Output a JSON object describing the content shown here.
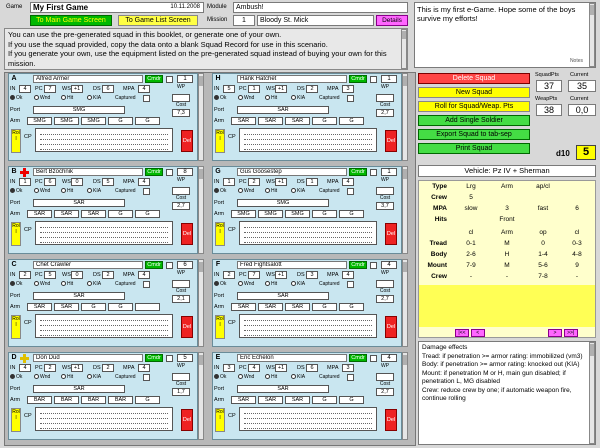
{
  "header": {
    "game_label": "Game",
    "game_name": "My First Game",
    "date": "10.11.2008",
    "module_label": "Module",
    "module_value": "Ambush!",
    "mission_label": "Mission",
    "mission_number": "1",
    "mission_name": "Bloody St. Mick",
    "details_btn": "Details",
    "main_btn": "To Main Game Screen",
    "table_btn": "To Game List Screen",
    "notes_text": "This is my first e-Game. Hope some of the boys survive my efforts!",
    "notes_label": "Notes"
  },
  "instructions": "You can use the pre-generated squad in this booklet, or generate one of your own.\nIf you use the squad provided, copy the data onto a blank Squad Record for use in this scenario.\nIf you generate your own, use the equipment listed on the pre-generated squad instead of buying your own for this mission.",
  "labels": {
    "cmdr": "Cmdr",
    "in": "IN",
    "pc": "PC",
    "ws": "WS",
    "ds": "DS",
    "mpa": "MPA",
    "ok": "Ok",
    "wnd": "Wnd",
    "hit": "Hit",
    "kia": "KIA",
    "captured": "Captured",
    "wp": "WP",
    "cost": "Cost",
    "port": "Port",
    "arm": "Arm",
    "cp": "CP",
    "roll": "Rol l",
    "del": "Del"
  },
  "squad_left": [
    {
      "letter": "A",
      "name": "Alfred Armer",
      "cmdr": "1",
      "in": "4",
      "pc": "7",
      "ws": "+1",
      "ds": "6",
      "mpa": "4",
      "wp": "",
      "cost": "7,3",
      "port": "SMG",
      "arm": [
        "SMG",
        "SMG",
        "SMG",
        "G",
        "G"
      ],
      "status": "Ok",
      "cross": false
    },
    {
      "letter": "B",
      "name": "Bert Bzochnik",
      "cmdr": "8",
      "in": "1",
      "pc": "6",
      "ws": "0",
      "ds": "5",
      "mpa": "4",
      "wp": "",
      "cost": "2,7",
      "port": "SAR",
      "arm": [
        "SAR",
        "SAR",
        "SAR",
        "G",
        "G"
      ],
      "status": "Ok",
      "cross": true
    },
    {
      "letter": "C",
      "name": "Chet Crawler",
      "cmdr": "6",
      "in": "2",
      "pc": "5",
      "ws": "0",
      "ds": "2",
      "mpa": "4",
      "wp": "",
      "cost": "2,1",
      "port": "SAR",
      "arm": [
        "SAR",
        "SAR",
        "G",
        "G",
        ""
      ],
      "status": "Ok",
      "cross": false
    },
    {
      "letter": "D",
      "name": "Don Dud",
      "cmdr": "5",
      "in": "4",
      "pc": "2",
      "ws": "+1",
      "ds": "2",
      "mpa": "4",
      "wp": "",
      "cost": "1,7",
      "port": "SAR",
      "arm": [
        "BAR",
        "BAR",
        "BAR",
        "BAR",
        "G"
      ],
      "status": "Ok",
      "cross": true
    }
  ],
  "squad_right": [
    {
      "letter": "H",
      "name": "Hank Hatchet",
      "cmdr": "1",
      "in": "5",
      "pc": "1",
      "ws": "+1",
      "ds": "2",
      "mpa": "3",
      "wp": "",
      "cost": "2,7",
      "port": "SAR",
      "arm": [
        "SAR",
        "SAR",
        "SAR",
        "G",
        "G"
      ],
      "status": "Ok",
      "cross": false
    },
    {
      "letter": "G",
      "name": "Gus Goosestep",
      "cmdr": "1",
      "in": "1",
      "pc": "2",
      "ws": "+1",
      "ds": "1",
      "mpa": "4",
      "wp": "",
      "cost": "3,7",
      "port": "SMG",
      "arm": [
        "SMG",
        "SMG",
        "SMG",
        "G",
        "G"
      ],
      "status": "Ok",
      "cross": false
    },
    {
      "letter": "F",
      "name": "Fred Fightsalott",
      "cmdr": "4",
      "in": "2",
      "pc": "7",
      "ws": "+1",
      "ds": "3",
      "mpa": "4",
      "wp": "",
      "cost": "2,7",
      "port": "SAR",
      "arm": [
        "SAR",
        "SAR",
        "SAR",
        "G",
        "G"
      ],
      "status": "Ok",
      "cross": false
    },
    {
      "letter": "E",
      "name": "Eric Echelon",
      "cmdr": "4",
      "in": "3",
      "pc": "4",
      "ws": "+1",
      "ds": "6",
      "mpa": "3",
      "wp": "",
      "cost": "2,7",
      "port": "SAR",
      "arm": [
        "SAR",
        "SAR",
        "SAR",
        "G",
        "G"
      ],
      "status": "Ok",
      "cross": false
    }
  ],
  "buttons": {
    "delete_squad": "Delete Squad",
    "new_squad": "New Squad",
    "roll": "Roll for Squad/Weap. Pts",
    "add_soldier": "Add Single Soldier",
    "export": "Export Squad to tab-sep",
    "print": "Print Squad"
  },
  "points": {
    "squad_pts_label": "SquadPts",
    "current_label": "Current",
    "squad_pts": "37",
    "squad_current": "35",
    "weap_pts_label": "WeapPts",
    "weap_current_label": "Current",
    "weap_pts": "38",
    "weap_current": "0,0"
  },
  "die": {
    "label": "d10",
    "value": "5"
  },
  "vehicle": {
    "title": "Vehicle: Pz IV + Sherman",
    "header": [
      "Type",
      "Lrg",
      "Arm",
      "ap/cl"
    ],
    "rows": [
      [
        "Crew",
        "5",
        "",
        ""
      ],
      [
        "MPA",
        "slow",
        "3",
        "fast",
        "6"
      ],
      [
        "Hits",
        "",
        "Front",
        ""
      ],
      [
        "",
        "cl",
        "Arm",
        "op",
        "cl"
      ],
      [
        "Tread",
        "0-1",
        "M",
        "0",
        "0-3"
      ],
      [
        "Body",
        "2-6",
        "H",
        "1-4",
        "4-8"
      ],
      [
        "Mount",
        "7-9",
        "M",
        "5-6",
        "9"
      ],
      [
        "Crew",
        "-",
        "-",
        "7-8",
        "-"
      ]
    ],
    "nav": [
      "|<<",
      "<",
      ">",
      ">>|"
    ]
  },
  "damage": {
    "title": "Damage effects",
    "text": "Tread: if penetration >= armor rating: immobilized (vm3)\nBody: if penetration >= armor rating: knocked out (KIA)\nMount: if penetration M or H, main gun disabled; if penetration L, MG disabled\nCrew: reduce crew by one; if automatic weapon fire, continue rolling"
  },
  "colors": {
    "card_bg": "#c9e6f0",
    "green": "#00b800",
    "red": "#ff4444",
    "yellow": "#ffff00",
    "vehicle_bg": "#ffffcc"
  }
}
